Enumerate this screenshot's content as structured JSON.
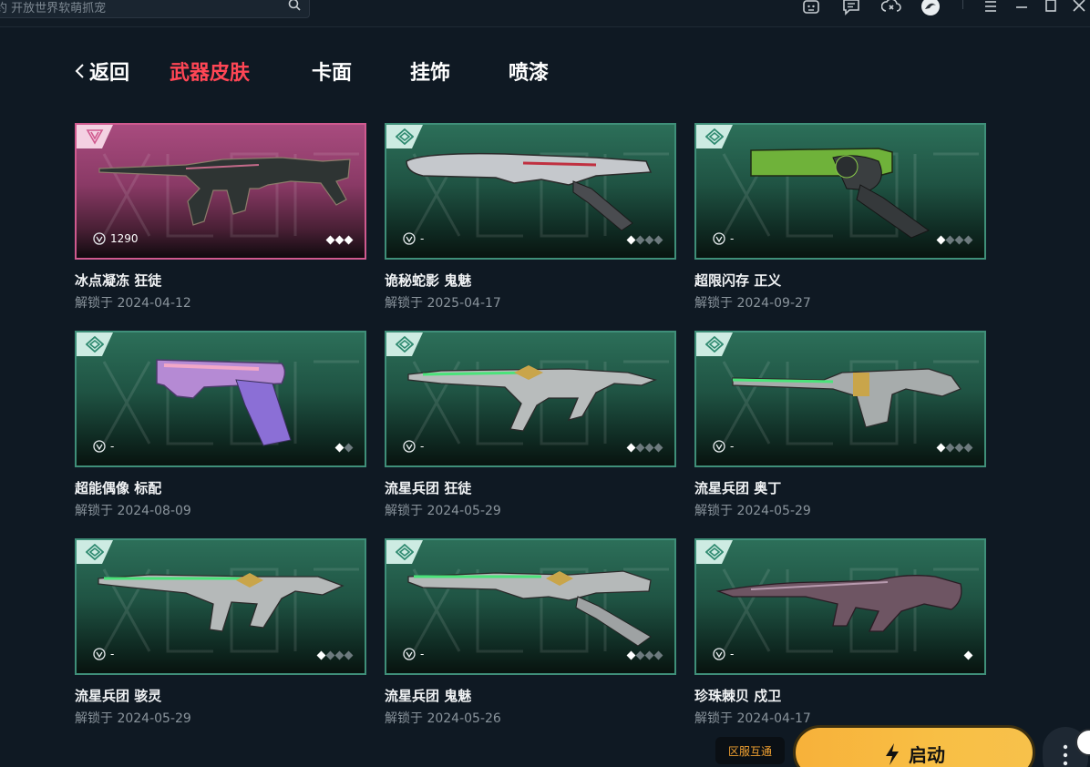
{
  "topbar": {
    "search_text": "约 开放世界软萌抓宠",
    "icons": [
      "robot-icon",
      "message-icon",
      "cloud-swap-icon",
      "avatar-icon",
      "menu-icon",
      "minimize-icon",
      "maximize-icon",
      "close-icon"
    ]
  },
  "nav": {
    "back_label": "返回",
    "tabs": [
      {
        "label": "武器皮肤",
        "active": true
      },
      {
        "label": "卡面",
        "active": false
      },
      {
        "label": "挂饰",
        "active": false
      },
      {
        "label": "喷漆",
        "active": false
      }
    ]
  },
  "skins": [
    {
      "name": "冰点凝冻 狂徒",
      "date": "解锁于 2024-04-12",
      "price": "1290",
      "tier": "premium",
      "pips_on": 3,
      "pips_total": 3,
      "colors": {
        "accent": "#d05a8f"
      }
    },
    {
      "name": "诡秘蛇影 鬼魅",
      "date": "解锁于 2025-04-17",
      "price": "-",
      "tier": "select",
      "pips_on": 1,
      "pips_total": 4
    },
    {
      "name": "超限闪存 正义",
      "date": "解锁于 2024-09-27",
      "price": "-",
      "tier": "select",
      "pips_on": 1,
      "pips_total": 4
    },
    {
      "name": "超能偶像 标配",
      "date": "解锁于 2024-08-09",
      "price": "-",
      "tier": "select",
      "pips_on": 1,
      "pips_total": 2
    },
    {
      "name": "流星兵团 狂徒",
      "date": "解锁于 2024-05-29",
      "price": "-",
      "tier": "select",
      "pips_on": 1,
      "pips_total": 4
    },
    {
      "name": "流星兵团 奥丁",
      "date": "解锁于 2024-05-29",
      "price": "-",
      "tier": "select",
      "pips_on": 1,
      "pips_total": 4
    },
    {
      "name": "流星兵团 骇灵",
      "date": "解锁于 2024-05-29",
      "price": "-",
      "tier": "select",
      "pips_on": 1,
      "pips_total": 4
    },
    {
      "name": "流星兵团 鬼魅",
      "date": "解锁于 2024-05-26",
      "price": "-",
      "tier": "select",
      "pips_on": 1,
      "pips_total": 4
    },
    {
      "name": "珍珠棘贝 戍卫",
      "date": "解锁于 2024-04-17",
      "price": "-",
      "tier": "select",
      "pips_on": 1,
      "pips_total": 1
    }
  ],
  "bottom": {
    "region_label": "区服互通",
    "launch_label": "启动"
  },
  "colors": {
    "background": "#0f1923",
    "active_tab": "#ff4655",
    "select_tier": "#3f8f79",
    "premium_tier": "#d05a8f",
    "launch": "#f7b13a",
    "region_text": "#f0a030"
  }
}
